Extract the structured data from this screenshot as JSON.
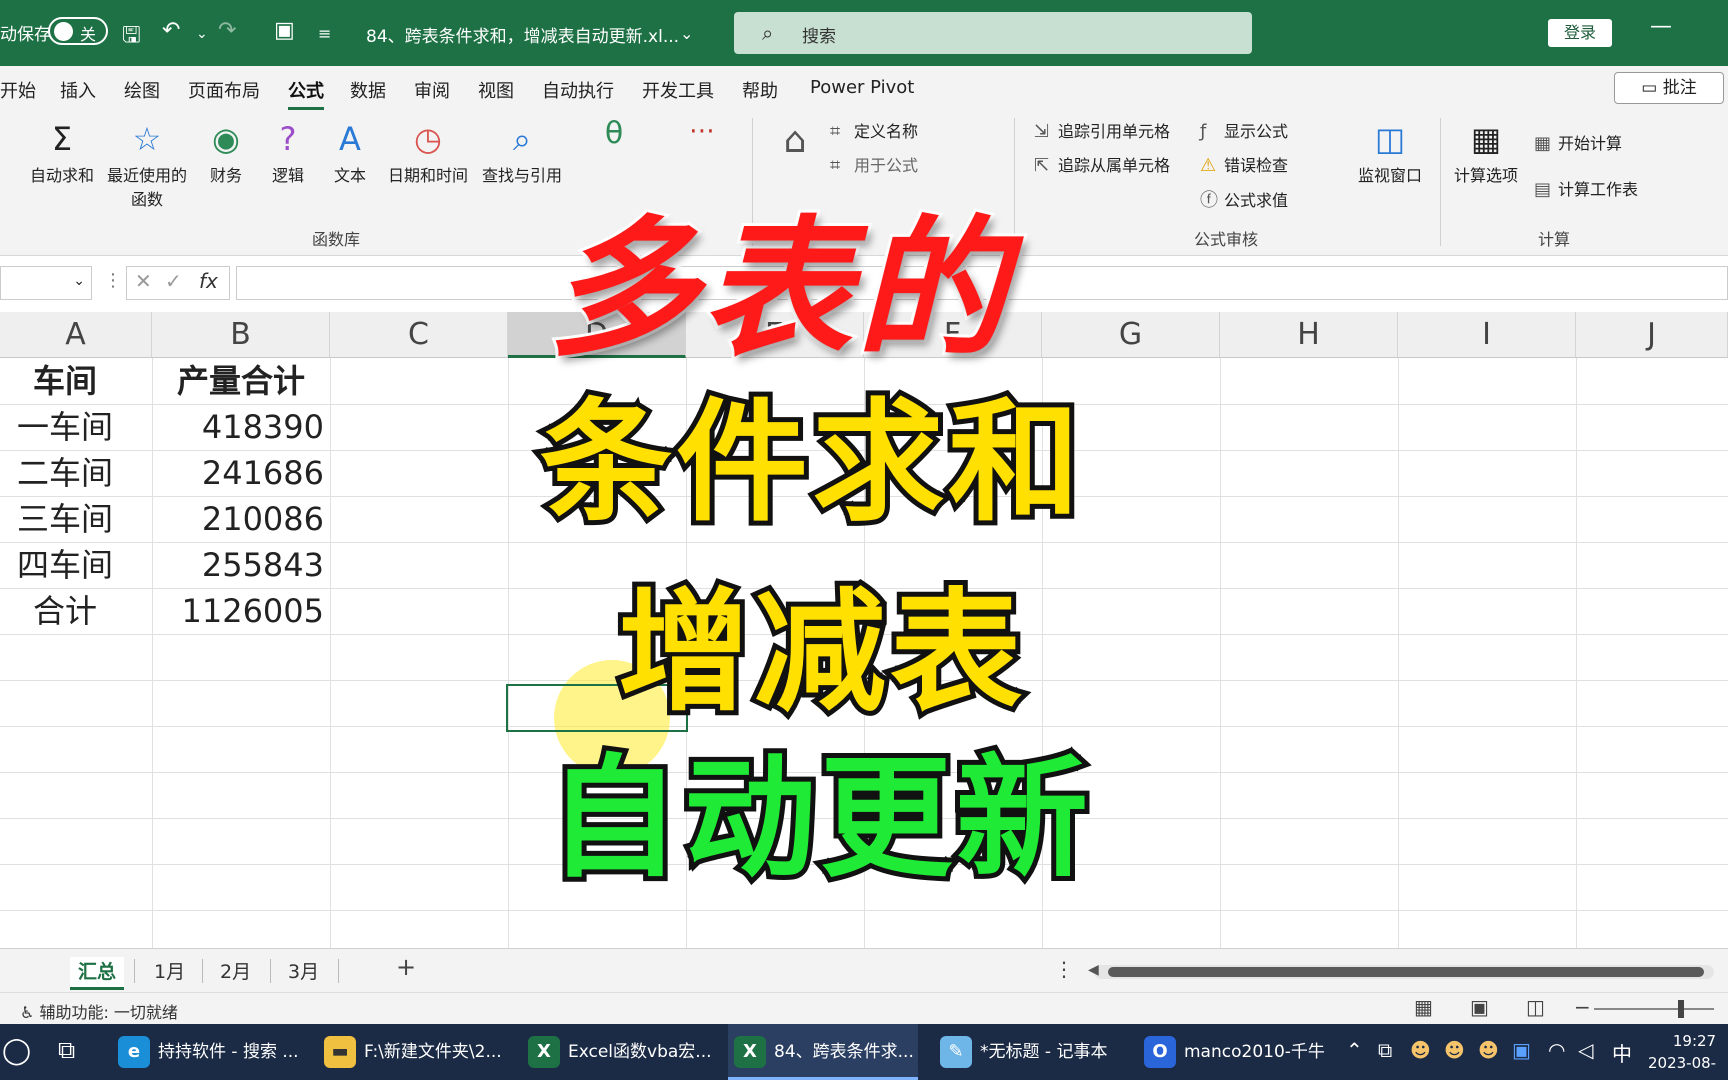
{
  "titlebar": {
    "autosave_label": "动保存",
    "autosave_state": "关",
    "document_name": "84、跨表条件求和，增减表自动更新.xl...",
    "search_placeholder": "搜索",
    "login_label": "登录",
    "minimize_label": "—"
  },
  "ribbon_tabs": [
    "开始",
    "插入",
    "绘图",
    "页面布局",
    "公式",
    "数据",
    "审阅",
    "视图",
    "自动执行",
    "开发工具",
    "帮助",
    "Power Pivot"
  ],
  "active_tab": "公式",
  "comments_label": "批注",
  "ribbon": {
    "function_library": {
      "buttons": [
        "自动求和",
        "最近使用的函数",
        "财务",
        "逻辑",
        "文本",
        "日期和时间",
        "查找与引用"
      ],
      "group_label": "函数库"
    },
    "defined_names": {
      "items": [
        "定义名称",
        "用于公式"
      ]
    },
    "formula_auditing": {
      "items": [
        "追踪引用单元格",
        "追踪从属单元格",
        "显示公式",
        "错误检查",
        "公式求值"
      ],
      "group_label": "公式审核"
    },
    "watch_window_label": "监视窗口",
    "calculation": {
      "options_label": "计算选项",
      "items": [
        "开始计算",
        "计算工作表"
      ],
      "group_label": "计算"
    }
  },
  "formula_bar": {
    "fx_label": "fx"
  },
  "grid": {
    "columns": [
      "A",
      "B",
      "C",
      "D",
      "E",
      "F",
      "G",
      "H",
      "I",
      "J"
    ],
    "selected_column": "D",
    "header_row": [
      "车间",
      "产量合计"
    ],
    "rows": [
      {
        "name": "一车间",
        "value": "418390"
      },
      {
        "name": "二车间",
        "value": "241686"
      },
      {
        "name": "三车间",
        "value": "210086"
      },
      {
        "name": "四车间",
        "value": "255843"
      },
      {
        "name": "合计",
        "value": "1126005"
      }
    ]
  },
  "overlay_title": {
    "line1": "多表的",
    "line2": "条件求和",
    "line3": "增减表",
    "line4": "自动更新",
    "colors": {
      "line1": "#ff1a1a",
      "line2": "#ffe000",
      "line3": "#ffe000",
      "line4": "#1fea35"
    }
  },
  "sheet_tabs": [
    "汇总",
    "1月",
    "2月",
    "3月"
  ],
  "active_sheet": "汇总",
  "add_sheet_label": "+",
  "status_bar": {
    "accessibility": "辅助功能: 一切就绪"
  },
  "taskbar": {
    "items": [
      {
        "label": "持持软件 - 搜索 ...",
        "icon": "edge-icon"
      },
      {
        "label": "F:\\新建文件夹\\2...",
        "icon": "folder-icon"
      },
      {
        "label": "Excel函数vba宏...",
        "icon": "excel-icon"
      },
      {
        "label": "84、跨表条件求...",
        "icon": "excel-icon"
      },
      {
        "label": "*无标题 - 记事本",
        "icon": "notepad-icon"
      },
      {
        "label": "manco2010-千牛",
        "icon": "qianniu-icon"
      }
    ],
    "active_index": 3,
    "ime": "中",
    "time": "19:27",
    "date": "2023-08-"
  },
  "accent_color": "#1e7145"
}
